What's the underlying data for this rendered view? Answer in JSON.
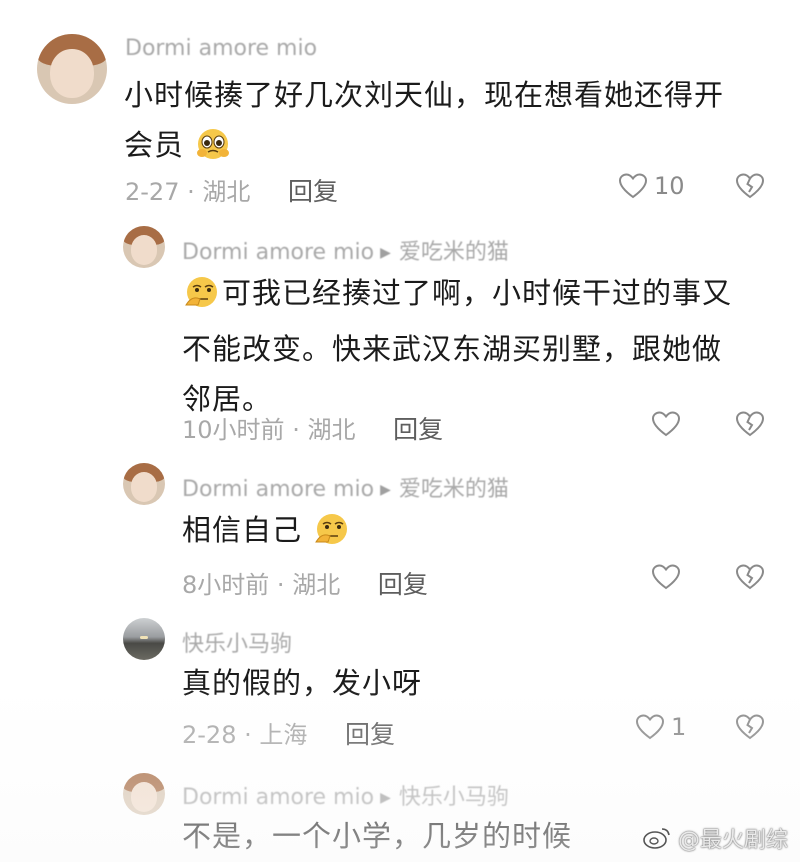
{
  "comments": [
    {
      "username": "Dormi amore mio",
      "text_lines": [
        "小时候揍了好几次刘天仙，现在想看她还得开",
        "会员"
      ],
      "date": "2-27",
      "location": "湖北",
      "reply_label": "回复",
      "likes": "10",
      "emoji": "pleading-face"
    },
    {
      "username": "Dormi amore mio",
      "reply_to": "爱吃米的猫",
      "text_lines": [
        "可我已经揍过了啊，小时候干过的事又",
        "不能改变。快来武汉东湖买别墅，跟她做",
        "邻居。"
      ],
      "time": "10小时前",
      "location": "湖北",
      "reply_label": "回复",
      "emoji": "thinking-face"
    },
    {
      "username": "Dormi amore mio",
      "reply_to": "爱吃米的猫",
      "text_lines": [
        "相信自己"
      ],
      "time": "8小时前",
      "location": "湖北",
      "reply_label": "回复",
      "emoji": "thinking-face"
    },
    {
      "username": "快乐小马驹",
      "text_lines": [
        "真的假的，发小呀"
      ],
      "date": "2-28",
      "location": "上海",
      "reply_label": "回复",
      "likes": "1"
    },
    {
      "username": "Dormi amore mio",
      "reply_to": "快乐小马驹",
      "text_lines": [
        "不是，一个小学，几岁的时候"
      ]
    }
  ],
  "meta_separator": "·",
  "watermark": "@最火剧综",
  "icons": {
    "like": "heart-outline-icon",
    "dislike": "broken-heart-icon",
    "arrow": "triangle-right-icon"
  }
}
